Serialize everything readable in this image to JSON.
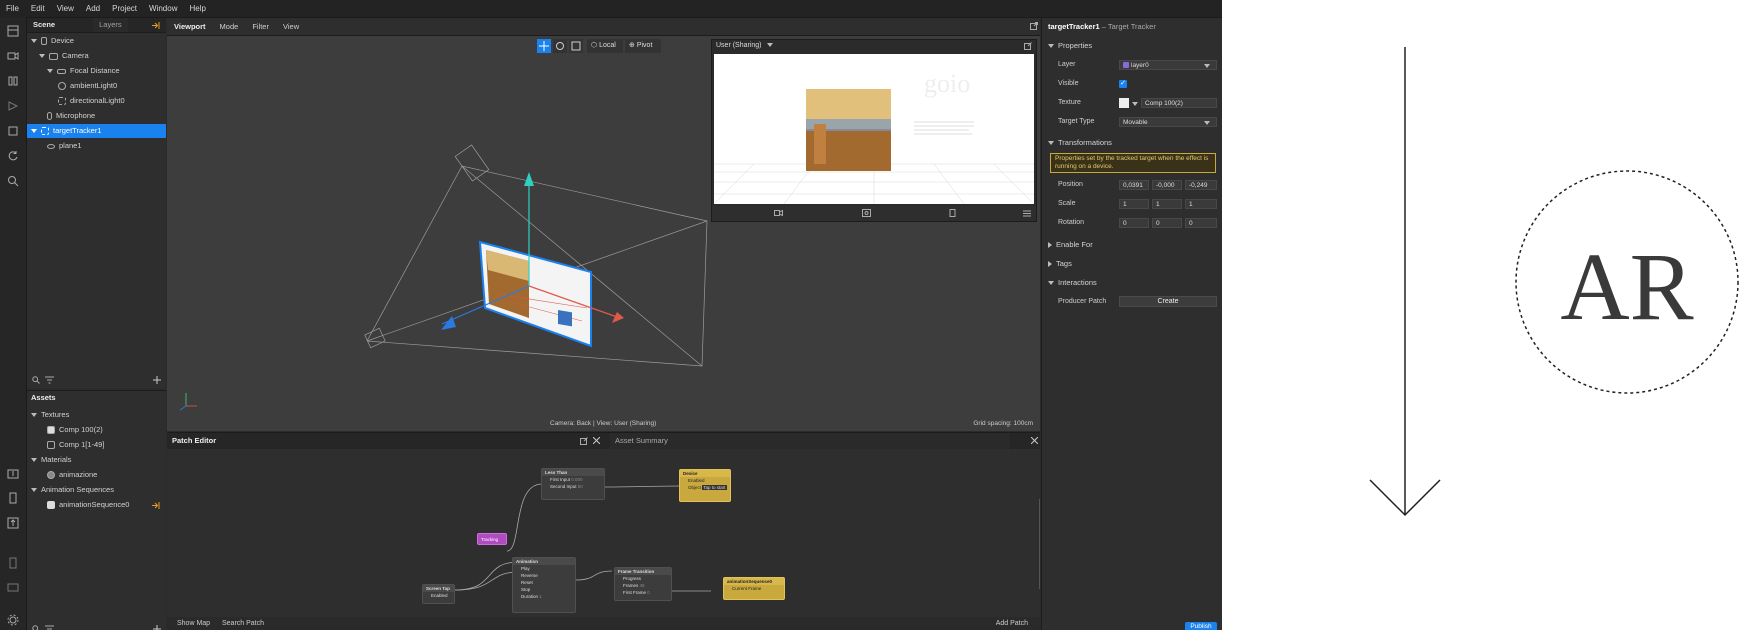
{
  "menu": [
    "File",
    "Edit",
    "View",
    "Add",
    "Project",
    "Window",
    "Help"
  ],
  "scene_panel": {
    "tabs": [
      "Scene",
      "Layers"
    ],
    "tree": [
      {
        "label": "Device",
        "indent": 0,
        "expanded": true,
        "icon": "device-icon"
      },
      {
        "label": "Camera",
        "indent": 1,
        "expanded": true,
        "icon": "camera-icon"
      },
      {
        "label": "Focal Distance",
        "indent": 2,
        "expanded": true,
        "icon": "focal-distance-icon"
      },
      {
        "label": "ambientLight0",
        "indent": 3,
        "icon": "ambient-light-icon"
      },
      {
        "label": "directionalLight0",
        "indent": 3,
        "icon": "directional-light-icon"
      },
      {
        "label": "Microphone",
        "indent": 1,
        "icon": "microphone-icon"
      },
      {
        "label": "targetTracker1",
        "indent": 0,
        "expanded": true,
        "selected": true,
        "icon": "target-tracker-icon"
      },
      {
        "label": "plane1",
        "indent": 1,
        "icon": "plane-icon"
      }
    ]
  },
  "assets_panel": {
    "title": "Assets",
    "groups": [
      {
        "label": "Textures",
        "items": [
          "Comp 100(2)",
          "Comp 1[1-49]"
        ]
      },
      {
        "label": "Materials",
        "items": [
          "animazione"
        ]
      },
      {
        "label": "Animation Sequences",
        "items": [
          "animationSequence0"
        ]
      }
    ]
  },
  "viewport": {
    "tabs": [
      "Viewport",
      "Mode",
      "Filter",
      "View"
    ],
    "toolbar": {
      "local": "Local",
      "pivot": "Pivot"
    },
    "status_camera": "Camera: Back | View: User (Sharing)",
    "status_grid": "Grid spacing: 100cm",
    "preview_title": "User (Sharing)"
  },
  "patch_editor": {
    "title": "Patch Editor",
    "asset_summary": "Asset Summary",
    "show_map": "Show Map",
    "search_patch": "Search Patch",
    "add_patch": "Add Patch",
    "nodes": {
      "less_than": {
        "title": "Less Than",
        "ports": [
          "First Input",
          "Second Input"
        ],
        "values": [
          "0.000",
          "50"
        ]
      },
      "device": {
        "title": "Device",
        "ports": [
          "Enabled",
          "Object"
        ],
        "values": [
          "",
          "Tap to start"
        ]
      },
      "tracking": {
        "title": "Tracking"
      },
      "animation": {
        "title": "Animation",
        "ports": [
          "Play",
          "Reverse",
          "Reset",
          "Stop",
          "Duration"
        ],
        "values": [
          "",
          "",
          "",
          "",
          "1"
        ]
      },
      "frame_transition": {
        "title": "Frame Transition",
        "ports": [
          "Progress",
          "Frames",
          "First Frame"
        ],
        "values": [
          "",
          "48",
          "0"
        ]
      },
      "screen_tap": {
        "title": "Screen Tap",
        "ports": [
          "Enabled"
        ]
      },
      "anim_seq": {
        "title": "animationSequence0",
        "ports": [
          "Current Frame"
        ]
      }
    }
  },
  "inspector": {
    "title": "targetTracker1",
    "subtitle": "– Target Tracker",
    "sections": {
      "properties": "Properties",
      "transformations": "Transformations",
      "enable_for": "Enable For",
      "tags": "Tags",
      "interactions": "Interactions"
    },
    "layer": {
      "label": "Layer",
      "value": "layer0"
    },
    "visible": {
      "label": "Visible"
    },
    "texture": {
      "label": "Texture",
      "value": "Comp 100(2)"
    },
    "target_type": {
      "label": "Target Type",
      "value": "Movable"
    },
    "notice": "Properties set by the tracked target when the effect is running on a device.",
    "position": {
      "label": "Position",
      "values": [
        "0,0391",
        "-0,000",
        "-0,249"
      ]
    },
    "scale": {
      "label": "Scale",
      "values": [
        "1",
        "1",
        "1"
      ]
    },
    "rotation": {
      "label": "Rotation",
      "values": [
        "0",
        "0",
        "0"
      ]
    },
    "producer_patch": {
      "label": "Producer Patch",
      "button": "Create"
    },
    "publish": "Publish"
  },
  "right_art": {
    "logo_text": "AR"
  },
  "colors": {
    "accent": "#1a82ee",
    "warning": "#c9a93d",
    "panel": "#2e2e2e"
  }
}
